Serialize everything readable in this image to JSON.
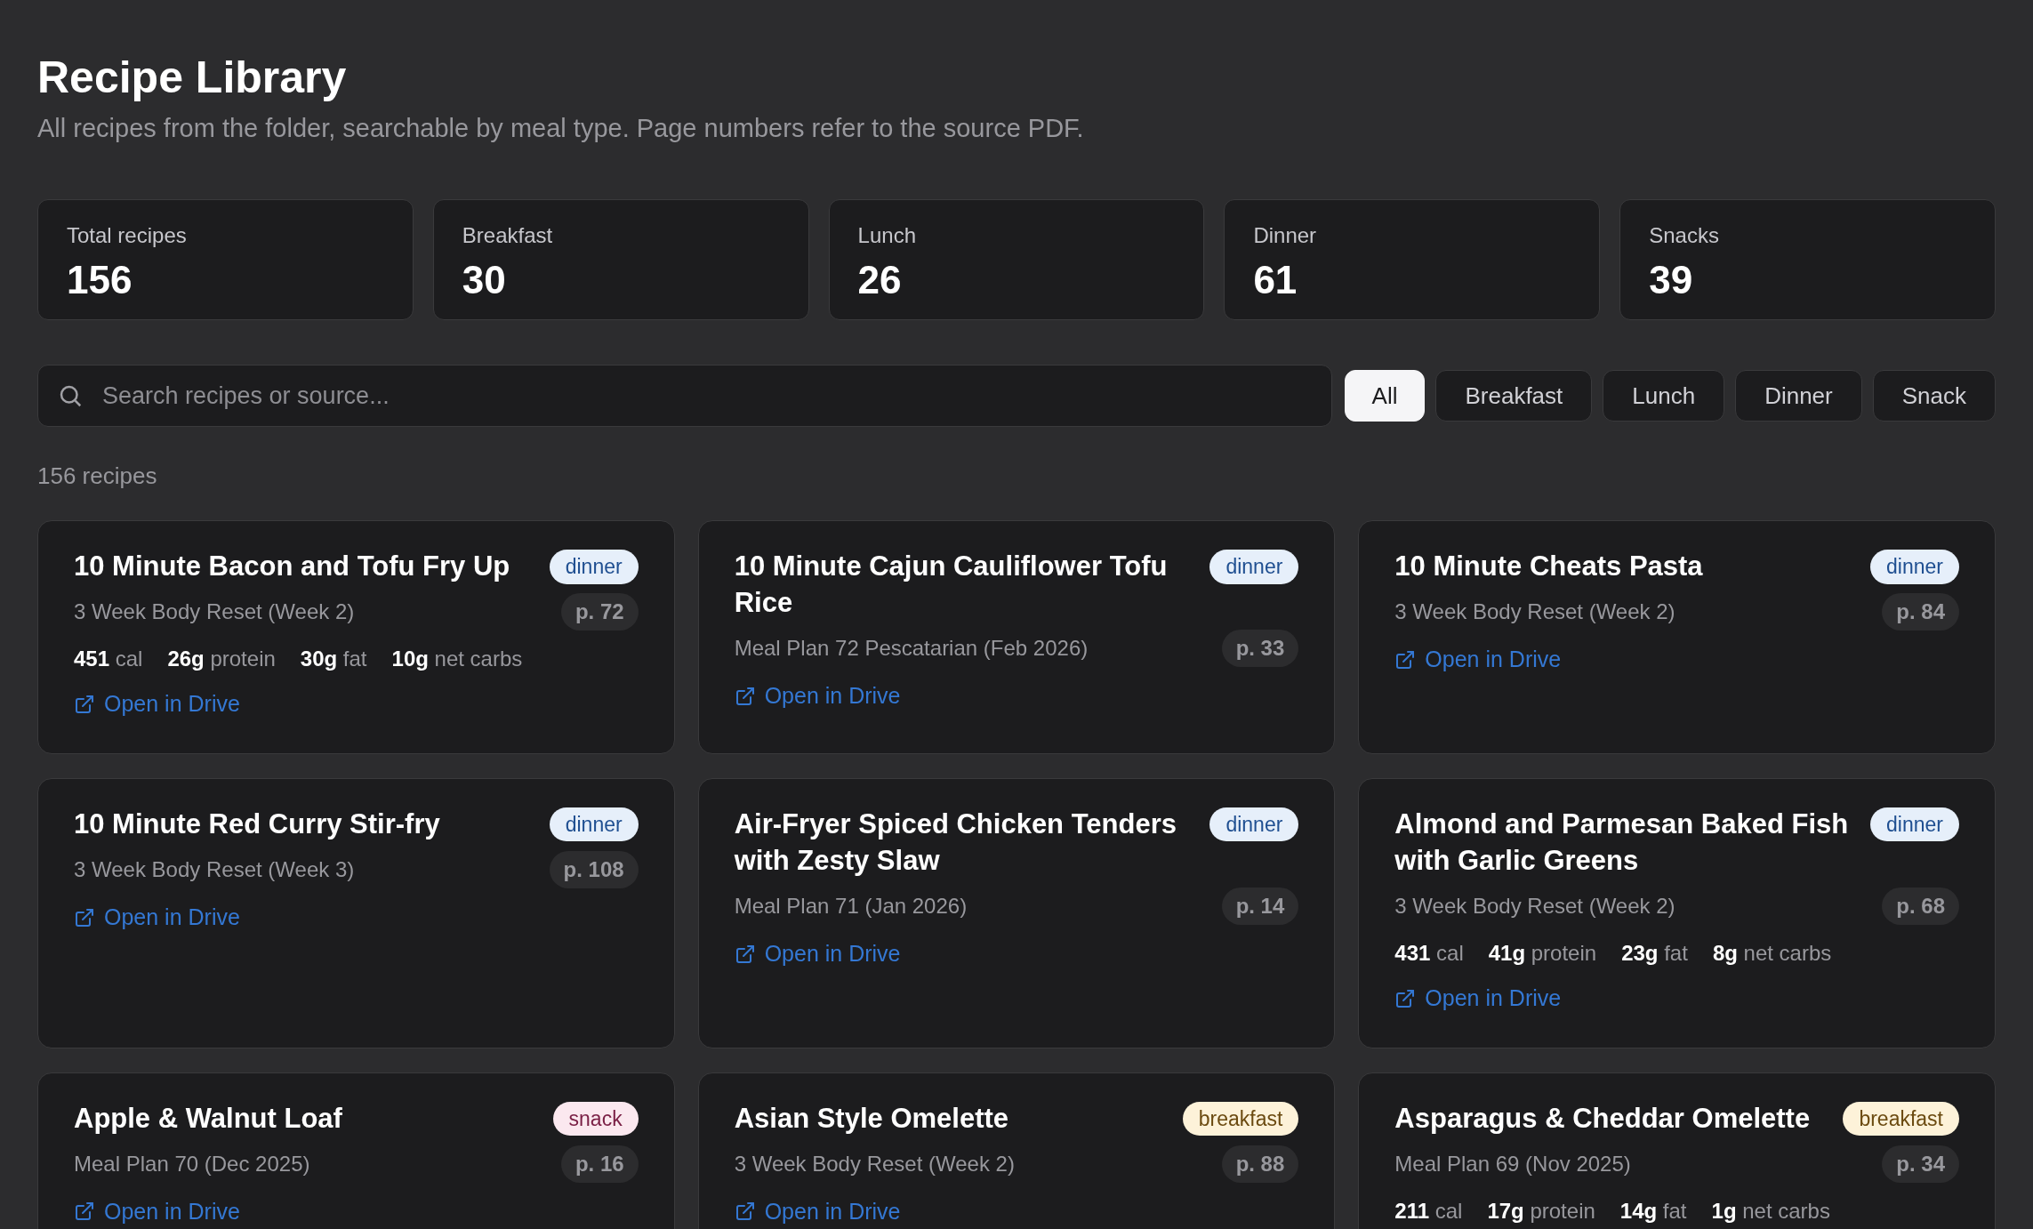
{
  "header": {
    "title": "Recipe Library",
    "subtitle": "All recipes from the folder, searchable by meal type. Page numbers refer to the source PDF."
  },
  "stats": [
    {
      "label": "Total recipes",
      "value": "156"
    },
    {
      "label": "Breakfast",
      "value": "30"
    },
    {
      "label": "Lunch",
      "value": "26"
    },
    {
      "label": "Dinner",
      "value": "61"
    },
    {
      "label": "Snacks",
      "value": "39"
    }
  ],
  "search": {
    "placeholder": "Search recipes or source..."
  },
  "filters": [
    {
      "label": "All",
      "selected": true
    },
    {
      "label": "Breakfast",
      "selected": false
    },
    {
      "label": "Lunch",
      "selected": false
    },
    {
      "label": "Dinner",
      "selected": false
    },
    {
      "label": "Snack",
      "selected": false
    }
  ],
  "result_count": "156 recipes",
  "recipes": [
    {
      "title": "10 Minute Bacon and Tofu Fry Up",
      "tag": "dinner",
      "kind": "dinner",
      "source": "3 Week Body Reset (Week 2)",
      "page": "p. 72",
      "macros": [
        "**451** cal",
        "**26g** protein",
        "**30g** fat",
        "**10g** net carbs"
      ],
      "link": "Open in Drive"
    },
    {
      "title": "10 Minute Cajun Cauliflower Tofu Rice",
      "tag": "dinner",
      "kind": "dinner",
      "source": "Meal Plan 72 Pescatarian (Feb 2026)",
      "page": "p. 33",
      "link": "Open in Drive"
    },
    {
      "title": "10 Minute Cheats Pasta",
      "tag": "dinner",
      "kind": "dinner",
      "source": "3 Week Body Reset (Week 2)",
      "page": "p. 84",
      "link": "Open in Drive"
    },
    {
      "title": "10 Minute Red Curry Stir-fry",
      "tag": "dinner",
      "kind": "dinner",
      "source": "3 Week Body Reset (Week 3)",
      "page": "p. 108",
      "link": "Open in Drive"
    },
    {
      "title": "Air-Fryer Spiced Chicken Tenders with Zesty Slaw",
      "tag": "dinner",
      "kind": "dinner",
      "source": "Meal Plan 71 (Jan 2026)",
      "page": "p. 14",
      "link": "Open in Drive"
    },
    {
      "title": "Almond and Parmesan Baked Fish with Garlic Greens",
      "tag": "dinner",
      "kind": "dinner",
      "source": "3 Week Body Reset (Week 2)",
      "page": "p. 68",
      "macros": [
        "**431** cal",
        "**41g** protein",
        "**23g** fat",
        "**8g** net carbs"
      ],
      "link": "Open in Drive"
    },
    {
      "title": "Apple & Walnut Loaf",
      "tag": "snack",
      "kind": "snack",
      "source": "Meal Plan 70 (Dec 2025)",
      "page": "p. 16",
      "link": "Open in Drive"
    },
    {
      "title": "Asian Style Omelette",
      "tag": "breakfast",
      "kind": "breakfast",
      "source": "3 Week Body Reset (Week 2)",
      "page": "p. 88",
      "link": "Open in Drive"
    },
    {
      "title": "Asparagus & Cheddar Omelette",
      "tag": "breakfast",
      "kind": "breakfast",
      "source": "Meal Plan 69 (Nov 2025)",
      "page": "p. 34",
      "macros": [
        "**211** cal",
        "**17g** protein",
        "**14g** fat",
        "**1g** net carbs"
      ]
    }
  ]
}
